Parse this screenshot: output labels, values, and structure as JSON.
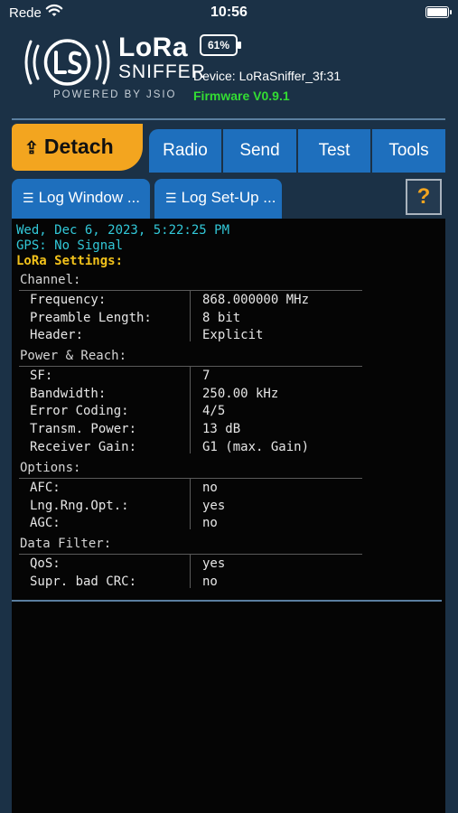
{
  "status_bar": {
    "carrier": "Rede",
    "time": "10:56"
  },
  "header": {
    "logo_line1": "LoRa",
    "logo_line2": "SNIFFER",
    "powered_by": "POWERED BY JSIO",
    "battery_percent": "61%",
    "device": "Device: LoRaSniffer_3f:31",
    "firmware": "Firmware V0.9.1"
  },
  "nav": {
    "detach_label": "Detach",
    "tabs": [
      "Radio",
      "Send",
      "Test",
      "Tools"
    ],
    "subtabs": [
      "Log Window ...",
      "Log Set-Up ..."
    ],
    "help_label": "?"
  },
  "log": {
    "timestamp": "Wed, Dec 6, 2023, 5:22:25 PM",
    "gps": "GPS: No Signal",
    "settings_heading": "LoRa Settings:",
    "sections": [
      {
        "title": "Channel:",
        "rows": [
          {
            "label": "Frequency:",
            "value": "868.000000 MHz"
          },
          {
            "label": "Preamble Length:",
            "value": "8 bit"
          },
          {
            "label": "Header:",
            "value": "Explicit"
          }
        ]
      },
      {
        "title": "Power & Reach:",
        "rows": [
          {
            "label": "SF:",
            "value": "7"
          },
          {
            "label": "Bandwidth:",
            "value": "250.00 kHz"
          },
          {
            "label": "Error Coding:",
            "value": "4/5"
          },
          {
            "label": "Transm. Power:",
            "value": "13 dB"
          },
          {
            "label": "Receiver Gain:",
            "value": "G1 (max. Gain)"
          }
        ]
      },
      {
        "title": "Options:",
        "rows": [
          {
            "label": "AFC:",
            "value": "no"
          },
          {
            "label": "Lng.Rng.Opt.:",
            "value": "yes"
          },
          {
            "label": "AGC:",
            "value": "no"
          }
        ]
      },
      {
        "title": "Data Filter:",
        "rows": [
          {
            "label": "QoS:",
            "value": "yes"
          },
          {
            "label": "Supr. bad CRC:",
            "value": "no"
          }
        ]
      }
    ]
  },
  "colors": {
    "accent": "#f3a51f",
    "tab_blue": "#1e6fbd",
    "background": "#1b3146",
    "firmware_green": "#33dd33"
  }
}
